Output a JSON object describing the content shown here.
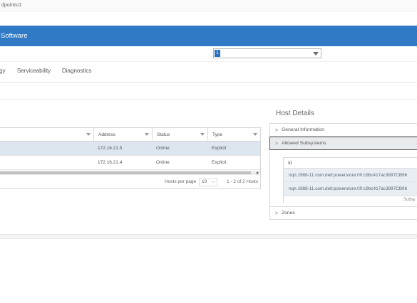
{
  "url": "dpoints/1",
  "banner": {
    "title": "Software"
  },
  "selector": {
    "value": "1"
  },
  "tabs": [
    {
      "label": "gy"
    },
    {
      "label": "Serviceability"
    },
    {
      "label": "Diagnostics"
    }
  ],
  "hosts_table": {
    "columns": [
      "",
      "Address",
      "Status",
      "Type"
    ],
    "rows": [
      {
        "address": "172.16.21.5",
        "status": "Online",
        "type": "Explicit"
      },
      {
        "address": "172.16.21.4",
        "status": "Online",
        "type": "Explicit"
      }
    ],
    "footer": {
      "per_page_label": "Hosts per page",
      "per_page_value": "10",
      "count": "1 - 2 of 2 Hosts"
    }
  },
  "host_details": {
    "title": "Host Details",
    "sections": {
      "general": "General Information",
      "subsystems": "Allowed Subsystems",
      "zones": "Zones"
    },
    "subsystems_table": {
      "header": "Id",
      "rows": [
        "nqn.1988-11.com.dell:powerstore:00:c9bc417ac3897CB96",
        "nqn.1988-11.com.dell:powerstore:00:c9bc417ac3897CB96"
      ],
      "footer": "Subsy"
    }
  },
  "colors": {
    "banner": "#2f79c5",
    "selected_row": "#dde6ef",
    "dropdown_value": "#2a6fbf"
  }
}
